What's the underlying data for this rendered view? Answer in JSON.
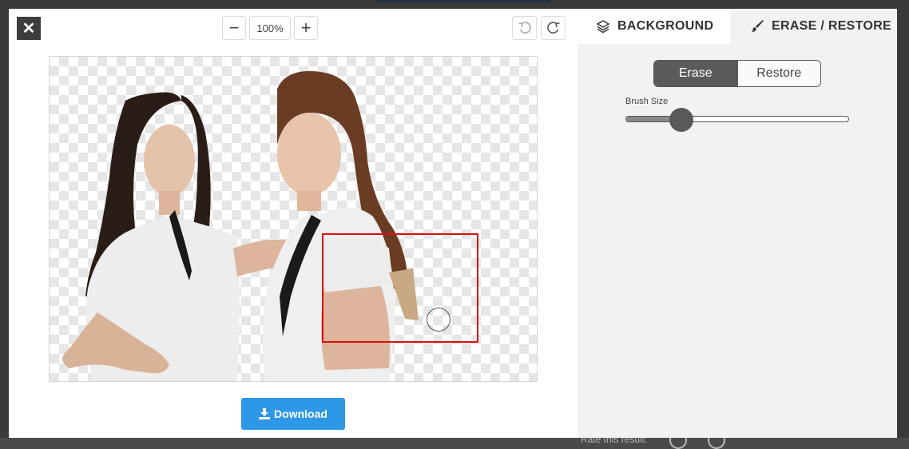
{
  "toolbar": {
    "close_icon": "close-icon",
    "zoom_out_label": "−",
    "zoom_level": "100%",
    "zoom_in_label": "+",
    "undo_icon": "undo-icon",
    "redo_icon": "redo-icon"
  },
  "download": {
    "label": "Download",
    "icon": "download-icon"
  },
  "panel": {
    "tabs": [
      {
        "label": "BACKGROUND",
        "icon": "layers-icon",
        "active": false
      },
      {
        "label": "ERASE / RESTORE",
        "icon": "brush-icon",
        "active": true
      }
    ],
    "mode": {
      "erase_label": "Erase",
      "restore_label": "Restore",
      "selected": "Erase"
    },
    "brush": {
      "label": "Brush Size",
      "value_fraction": 0.25
    }
  },
  "background_page": {
    "rate_label": "Rate this result:"
  },
  "colors": {
    "accent": "#2d97e8",
    "selection": "#d81010",
    "dark_button": "#3d3d3d",
    "panel_bg": "#f2f2f2"
  }
}
